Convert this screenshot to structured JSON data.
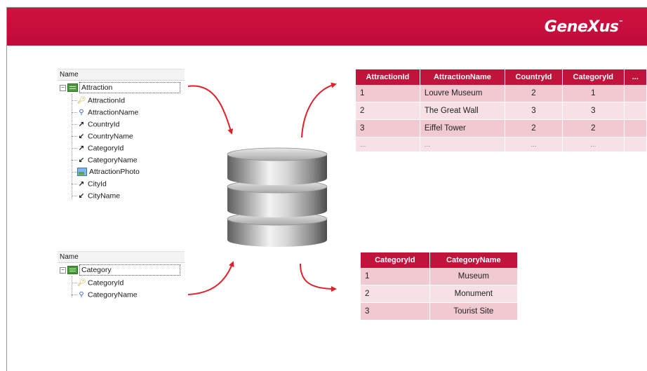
{
  "brand": {
    "logo_text": "GeneXus",
    "trademark": "™",
    "header_color": "#c8103c"
  },
  "attraction_tree": {
    "header": "Name",
    "root": "Attraction",
    "attributes": [
      {
        "name": "AttractionId",
        "icon": "key-icon"
      },
      {
        "name": "AttractionName",
        "icon": "description-icon"
      },
      {
        "name": "CountryId",
        "icon": "foreign-key-icon"
      },
      {
        "name": "CountryName",
        "icon": "inferred-attribute-icon"
      },
      {
        "name": "CategoryId",
        "icon": "foreign-key-icon"
      },
      {
        "name": "CategoryName",
        "icon": "inferred-attribute-icon"
      },
      {
        "name": "AttractionPhoto",
        "icon": "image-icon"
      },
      {
        "name": "CityId",
        "icon": "foreign-key-icon"
      },
      {
        "name": "CityName",
        "icon": "inferred-attribute-icon"
      }
    ]
  },
  "category_tree": {
    "header": "Name",
    "root": "Category",
    "attributes": [
      {
        "name": "CategoryId",
        "icon": "key-icon"
      },
      {
        "name": "CategoryName",
        "icon": "description-icon"
      }
    ]
  },
  "attraction_table": {
    "columns": [
      "AttractionId",
      "AttractionName",
      "CountryId",
      "CategoryId",
      "..."
    ],
    "rows": [
      [
        "1",
        "Louvre Museum",
        "2",
        "1",
        ""
      ],
      [
        "2",
        "The Great Wall",
        "3",
        "3",
        ""
      ],
      [
        "3",
        "Eiffel Tower",
        "2",
        "2",
        ""
      ],
      [
        "...",
        "...",
        "...",
        "...",
        ""
      ]
    ]
  },
  "category_table": {
    "columns": [
      "CategoryId",
      "CategoryName"
    ],
    "rows": [
      [
        "1",
        "Museum"
      ],
      [
        "2",
        "Monument"
      ],
      [
        "3",
        "Tourist Site"
      ]
    ]
  },
  "colors": {
    "table_header": "#c1143d",
    "row_dark": "#f0c9d1",
    "row_light": "#f7e1e5",
    "arrow": "#e0202a"
  }
}
